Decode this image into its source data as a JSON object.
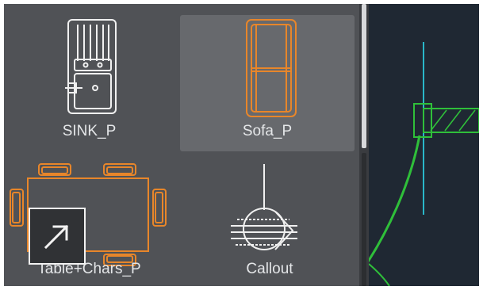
{
  "palette": {
    "items": [
      {
        "label": "SINK_P",
        "icon": "sink-block-icon",
        "selected": false
      },
      {
        "label": "Sofa_P",
        "icon": "sofa-block-icon",
        "selected": true
      },
      {
        "label": "Table+Chars_P",
        "icon": "table-chairs-block-icon",
        "selected": false
      },
      {
        "label": "Callout",
        "icon": "callout-block-icon",
        "selected": false
      }
    ]
  },
  "overlay": {
    "icon": "expand-arrow-icon"
  },
  "colors": {
    "block_orange": "#e8862a",
    "selected_tile": "#67696d",
    "drawing_cyan": "#2ab7c9",
    "drawing_green": "#2fbf3a",
    "canvas_bg": "#1f2833"
  }
}
